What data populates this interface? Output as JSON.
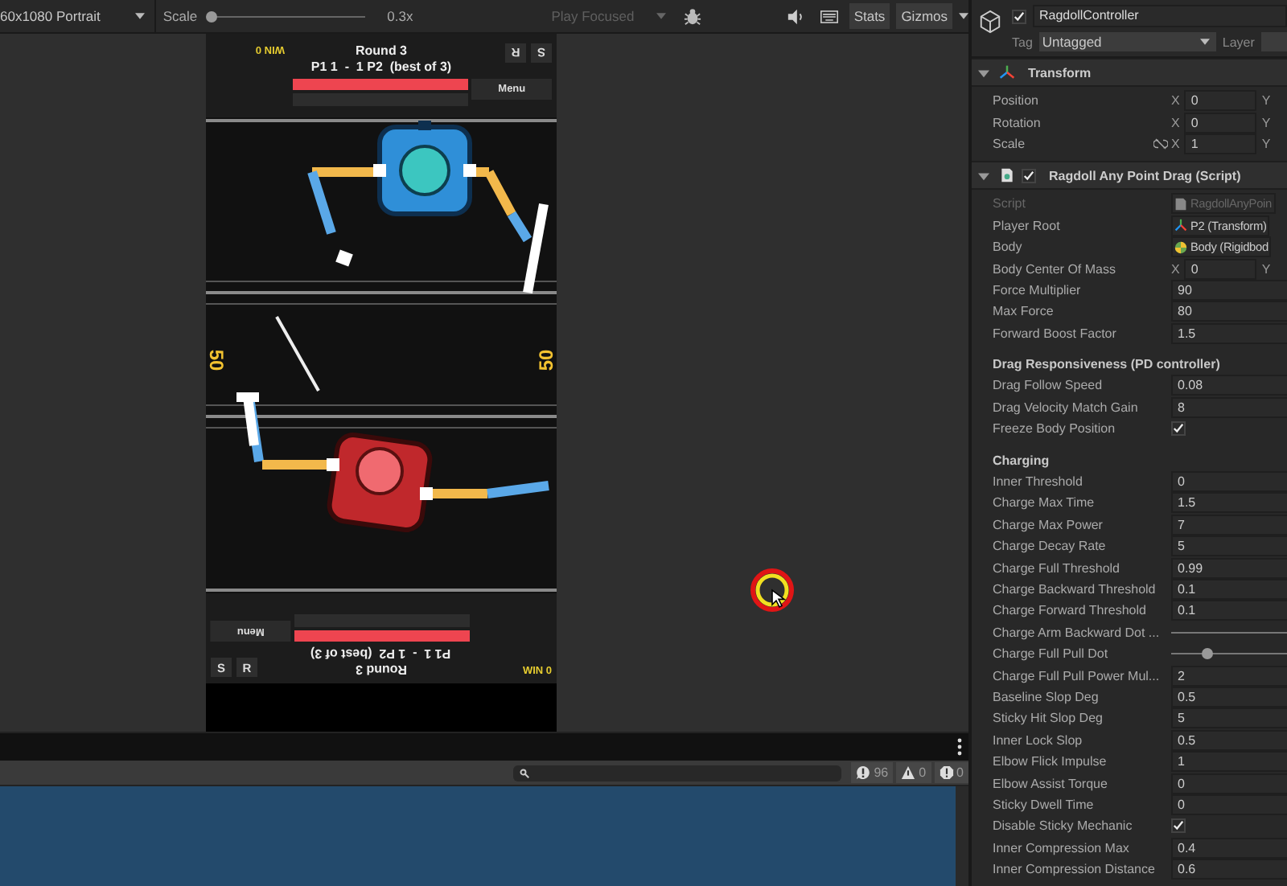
{
  "toolbar": {
    "resolution": "60x1080 Portrait",
    "scale_label": "Scale",
    "scale": {
      "level": 0.0
    },
    "scale_value": "0.3x",
    "play_mode": {
      "label": "Play Focused",
      "disabled": true
    },
    "stats": "Stats",
    "gizmos": "Gizmos"
  },
  "game": {
    "top_hud": {
      "wins": "WIN 0",
      "round": "Round 3",
      "score": "P1 1  -  1 P2  (best of 3)",
      "menu": "Menu",
      "buttons": [
        "R",
        "S"
      ]
    },
    "side_scores": [
      "50",
      "50"
    ],
    "bottom_hud": {
      "wins": "WIN 0",
      "round": "Round 3",
      "score": "P1 1  -  1 P2  (best of 3)",
      "menu": "Menu",
      "buttons": [
        "S",
        "R"
      ]
    }
  },
  "console": {
    "counts": [
      {
        "kind": "info",
        "count": "96"
      },
      {
        "kind": "warning",
        "count": "0"
      },
      {
        "kind": "error",
        "count": "0"
      }
    ]
  },
  "inspector": {
    "object": {
      "enabled": true,
      "name": "RagdollController",
      "tag_label": "Tag",
      "tag": "Untagged",
      "layer_label": "Layer"
    },
    "components": [
      {
        "title": "Transform",
        "expanded": true,
        "fields": [
          {
            "kind": "vector",
            "label": "Position",
            "axes": [
              {
                "axis": "X",
                "value": "0"
              },
              {
                "axis": "Y"
              }
            ]
          },
          {
            "kind": "vector",
            "label": "Rotation",
            "axes": [
              {
                "axis": "X",
                "value": "0"
              },
              {
                "axis": "Y"
              }
            ]
          },
          {
            "kind": "vector",
            "label": "Scale",
            "proportions_icon": true,
            "axes": [
              {
                "axis": "X",
                "value": "1"
              },
              {
                "axis": "Y"
              }
            ]
          }
        ]
      },
      {
        "title": "Ragdoll Any Point Drag (Script)",
        "enabled": true,
        "expanded": true,
        "fields": [
          {
            "kind": "object",
            "label": "Script",
            "value": "RagdollAnyPoin",
            "disabled": true
          },
          {
            "kind": "object",
            "label": "Player Root",
            "value": "P2 (Transform)"
          },
          {
            "kind": "object",
            "label": "Body",
            "value": "Body (Rigidbod"
          },
          {
            "kind": "vector",
            "label": "Body Center Of Mass",
            "axes": [
              {
                "axis": "X",
                "value": "0"
              },
              {
                "axis": "Y"
              }
            ]
          },
          {
            "kind": "float",
            "label": "Force Multiplier",
            "value": "90"
          },
          {
            "kind": "float",
            "label": "Max Force",
            "value": "80"
          },
          {
            "kind": "float",
            "label": "Forward Boost Factor",
            "value": "1.5"
          },
          {
            "kind": "header",
            "label": "Drag Responsiveness (PD controller)"
          },
          {
            "kind": "float",
            "label": "Drag Follow Speed",
            "value": "0.08"
          },
          {
            "kind": "float",
            "label": "Drag Velocity Match Gain",
            "value": "8"
          },
          {
            "kind": "toggle",
            "label": "Freeze Body Position",
            "checked": true
          },
          {
            "kind": "header",
            "label": "Charging"
          },
          {
            "kind": "float",
            "label": "Inner Threshold",
            "value": "0"
          },
          {
            "kind": "float",
            "label": "Charge Max Time",
            "value": "1.5"
          },
          {
            "kind": "float",
            "label": "Charge Max Power",
            "value": "7"
          },
          {
            "kind": "float",
            "label": "Charge Decay Rate",
            "value": "5"
          },
          {
            "kind": "float",
            "label": "Charge Full Threshold",
            "value": "0.99"
          },
          {
            "kind": "float",
            "label": "Charge Backward Threshold",
            "value": "0.1"
          },
          {
            "kind": "float",
            "label": "Charge Forward Threshold",
            "value": "0.1"
          },
          {
            "kind": "slider",
            "label": "Charge Arm Backward Dot ..."
          },
          {
            "kind": "slider",
            "label": "Charge Full Pull Dot",
            "level": 0.22
          },
          {
            "kind": "float",
            "label": "Charge Full Pull Power Mul...",
            "value": "2"
          },
          {
            "kind": "float",
            "label": "Baseline Slop Deg",
            "value": "0.5"
          },
          {
            "kind": "float",
            "label": "Sticky Hit Slop Deg",
            "value": "5"
          },
          {
            "kind": "float",
            "label": "Inner Lock Slop",
            "value": "0.5"
          },
          {
            "kind": "float",
            "label": "Elbow Flick Impulse",
            "value": "1"
          },
          {
            "kind": "float",
            "label": "Elbow Assist Torque",
            "value": "0"
          },
          {
            "kind": "float",
            "label": "Sticky Dwell Time",
            "value": "0"
          },
          {
            "kind": "toggle",
            "label": "Disable Sticky Mechanic",
            "checked": true
          },
          {
            "kind": "float",
            "label": "Inner Compression Max",
            "value": "0.4"
          },
          {
            "kind": "float",
            "label": "Inner Compression Distance",
            "value": "0.6"
          }
        ]
      }
    ]
  }
}
